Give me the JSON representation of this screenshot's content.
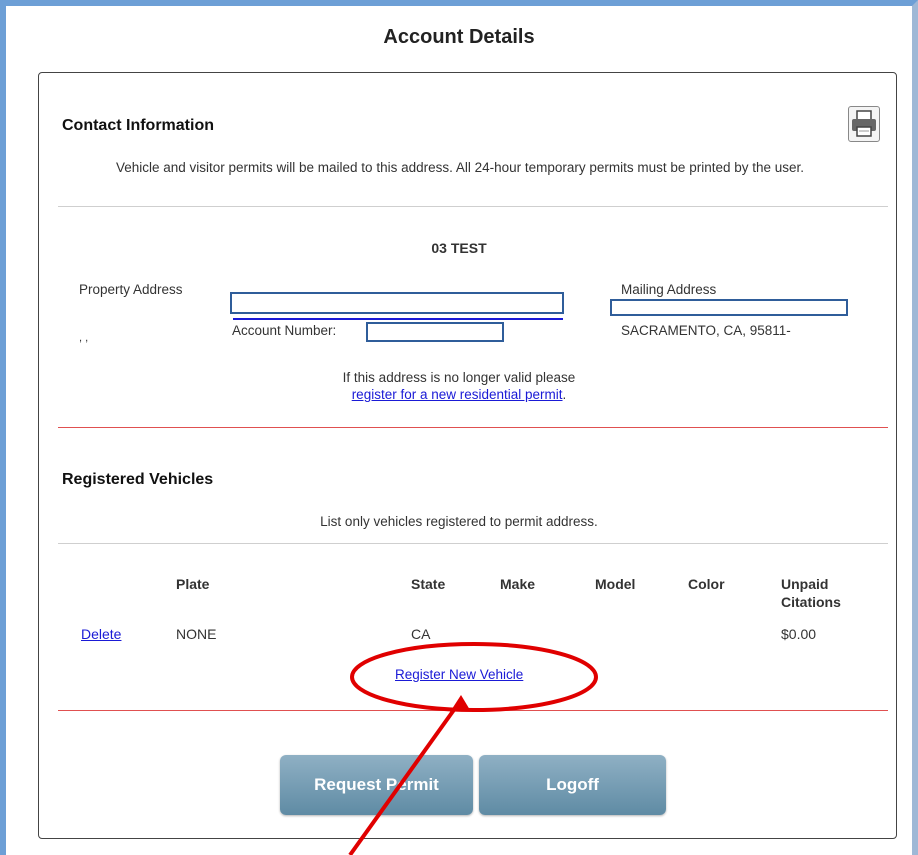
{
  "page_title": "Account Details",
  "contact": {
    "heading": "Contact Information",
    "note": "Vehicle and visitor permits will be mailed to this address. All 24-hour temporary permits must be printed by the user.",
    "account_name": "03 TEST",
    "property_label": "Property Address",
    "property_value": ", ,",
    "account_number_label": "Account Number:",
    "mailing_label": "Mailing Address",
    "mailing_city": "SACRAMENTO, CA, 95811-",
    "invalid_text": "If this address is no longer valid please",
    "register_link": "register for a new residential permit",
    "period": "."
  },
  "vehicles": {
    "heading": "Registered Vehicles",
    "note": "List only vehicles registered to permit address.",
    "columns": [
      "Plate",
      "State",
      "Make",
      "Model",
      "Color",
      "Unpaid",
      "Citations"
    ],
    "rows": [
      {
        "action": "Delete",
        "plate": "NONE",
        "state": "CA",
        "make": "",
        "model": "",
        "color": "",
        "unpaid": "$0.00"
      }
    ],
    "register_vehicle": "Register New Vehicle"
  },
  "buttons": {
    "request_permit": "Request Permit",
    "logoff": "Logoff"
  },
  "colors": {
    "frame": "#6d9fd6",
    "link": "#1a1ad6",
    "divider_red": "#e05050",
    "annotation_red": "#e00000",
    "button": "#6f98b0"
  },
  "icons": {
    "print": "printer-icon"
  }
}
